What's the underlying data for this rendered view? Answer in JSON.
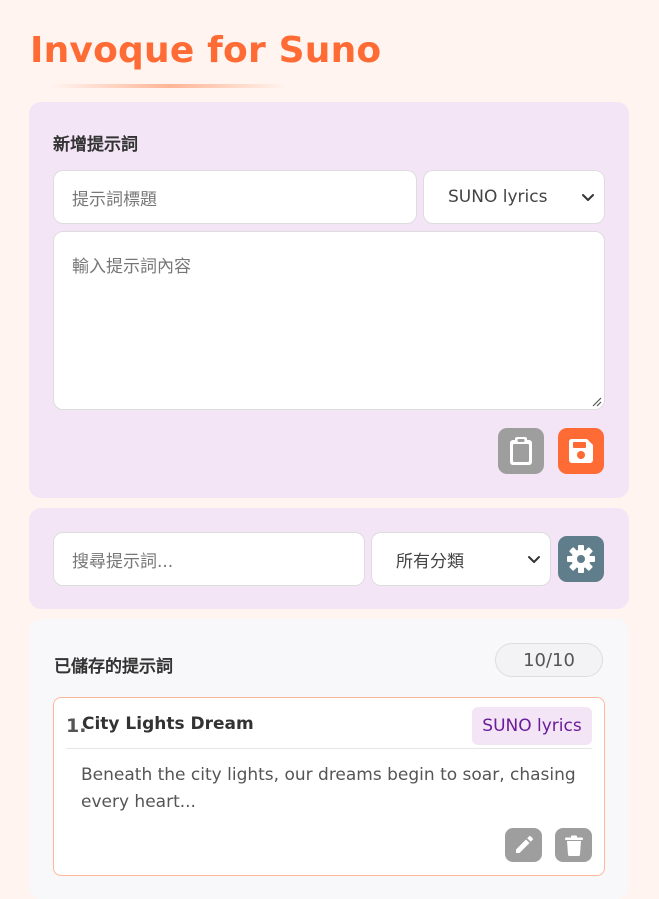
{
  "app": {
    "title": "Invoque for Suno"
  },
  "add_section": {
    "heading": "新增提示詞",
    "title_placeholder": "提示詞標題",
    "category_selected": "SUNO lyrics",
    "content_placeholder": "輸入提示詞內容",
    "paste_icon": "clipboard-icon",
    "save_icon": "save-icon"
  },
  "search_section": {
    "search_placeholder": "搜尋提示詞...",
    "filter_selected": "所有分類",
    "settings_icon": "gear-icon"
  },
  "saved_section": {
    "heading": "已儲存的提示詞",
    "count": "10/10",
    "items": [
      {
        "number": "1.",
        "title": "City Lights Dream",
        "category": "SUNO lyrics",
        "preview": "Beneath the city lights, our dreams begin to soar, chasing every heart...",
        "edit_icon": "pencil-icon",
        "delete_icon": "trash-icon"
      }
    ]
  },
  "colors": {
    "accent": "#ff6b35",
    "panel": "#f3e5f5",
    "badge_text": "#6a1b9a",
    "settings_button": "#607d8b",
    "neutral_button": "#9e9e9e"
  }
}
